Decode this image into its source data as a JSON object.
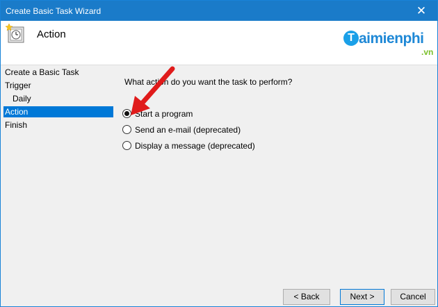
{
  "window": {
    "title": "Create Basic Task Wizard",
    "close_glyph": "✕"
  },
  "header": {
    "title": "Action",
    "icon": "task-scheduler-clock-icon"
  },
  "watermark": {
    "logo_letter": "T",
    "name": "aimienphi",
    "tld": ".vn"
  },
  "steps": [
    {
      "label": "Create a Basic Task",
      "active": false
    },
    {
      "label": "Trigger",
      "active": false
    },
    {
      "label": "Daily",
      "active": false
    },
    {
      "label": "Action",
      "active": true
    },
    {
      "label": "Finish",
      "active": false
    }
  ],
  "content": {
    "question": "What action do you want the task to perform?",
    "options": [
      {
        "label": "Start a program",
        "selected": true
      },
      {
        "label": "Send an e-mail (deprecated)",
        "selected": false
      },
      {
        "label": "Display a message (deprecated)",
        "selected": false
      }
    ]
  },
  "buttons": {
    "back": "< Back",
    "next": "Next >",
    "cancel": "Cancel"
  },
  "colors": {
    "titlebar": "#1a7bc9",
    "selection": "#0078d7",
    "annotation_arrow": "#e01b1b"
  }
}
